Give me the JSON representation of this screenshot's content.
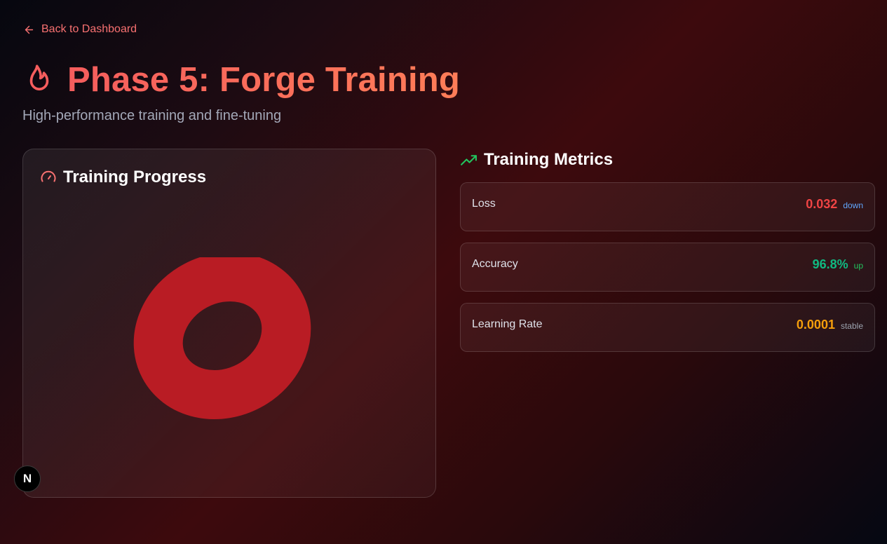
{
  "nav": {
    "back_label": "Back to Dashboard"
  },
  "header": {
    "title": "Phase 5: Forge Training",
    "subtitle": "High-performance training and fine-tuning"
  },
  "progress_card": {
    "title": "Training Progress",
    "ring_color": "#b91c24"
  },
  "metrics": {
    "title": "Training Metrics",
    "items": [
      {
        "label": "Loss",
        "value": "0.032",
        "trend": "down",
        "value_color": "#ef4444",
        "trend_color": "#60a5fa"
      },
      {
        "label": "Accuracy",
        "value": "96.8%",
        "trend": "up",
        "value_color": "#10b981",
        "trend_color": "#22c55e"
      },
      {
        "label": "Learning Rate",
        "value": "0.0001",
        "trend": "stable",
        "value_color": "#f59e0b",
        "trend_color": "#9ca3af"
      }
    ]
  },
  "badge": {
    "letter": "N"
  },
  "icons": {
    "back": "arrow-left-icon",
    "title": "flame-icon",
    "progress": "gauge-icon",
    "metrics": "trending-up-icon"
  },
  "colors": {
    "accent": "#f87171",
    "title_gradient_start": "#f55d5d",
    "title_gradient_end": "#ff7d58",
    "metrics_icon": "#22c55e"
  }
}
